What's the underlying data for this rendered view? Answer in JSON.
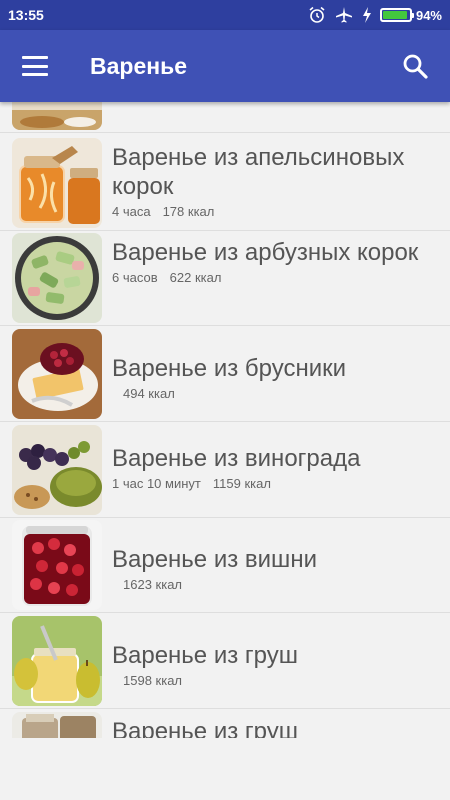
{
  "status_bar": {
    "time": "13:55",
    "icons": [
      "alarm-icon",
      "airplane-icon",
      "charging-icon"
    ],
    "battery_text": "94%",
    "battery_level": 0.94
  },
  "app_bar": {
    "title": "Варенье",
    "menu_icon": "hamburger-menu-icon",
    "search_icon": "search-icon"
  },
  "recipes": [
    {
      "name": "",
      "time": "",
      "kcal": ""
    },
    {
      "name": "Варенье из апельсиновых корок",
      "time": "4 часа",
      "kcal": "178 ккал"
    },
    {
      "name": "Варенье из арбузных корок",
      "time": "6 часов",
      "kcal": "622 ккал"
    },
    {
      "name": "Варенье из брусники",
      "time": "",
      "kcal": "494 ккал"
    },
    {
      "name": "Варенье из винограда",
      "time": "1 час 10 минут",
      "kcal": "1159 ккал"
    },
    {
      "name": "Варенье из вишни",
      "time": "",
      "kcal": "1623 ккал"
    },
    {
      "name": "Варенье из груш",
      "time": "",
      "kcal": "1598 ккал"
    },
    {
      "name": "Варенье из груш",
      "time": "",
      "kcal": ""
    }
  ]
}
